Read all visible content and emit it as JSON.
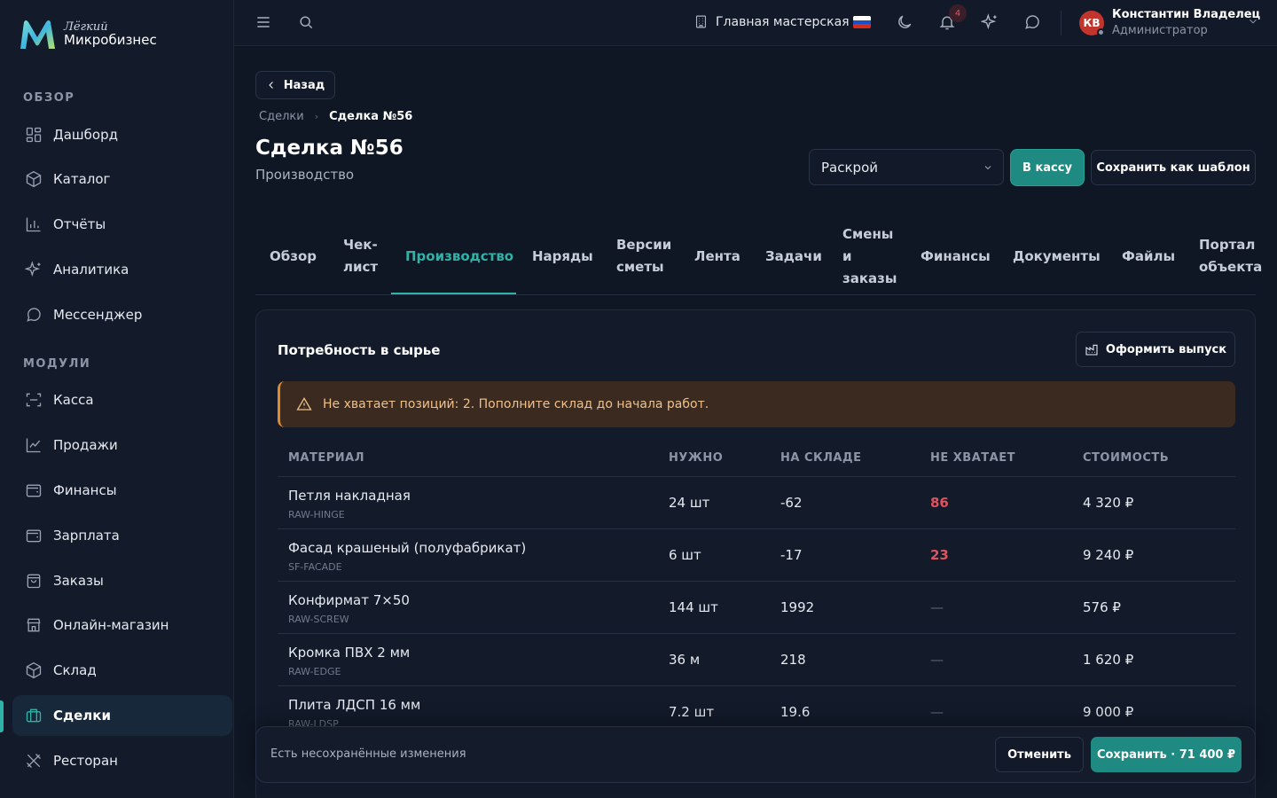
{
  "app": {
    "logo_top": "Лёгкий",
    "logo_bottom": "Микробизнес"
  },
  "sidebar": {
    "section_overview": "ОБЗОР",
    "section_modules": "МОДУЛИ",
    "items": [
      {
        "label": "Дашборд",
        "icon": "dashboard-icon"
      },
      {
        "label": "Каталог",
        "icon": "catalog-icon"
      },
      {
        "label": "Отчёты",
        "icon": "reports-icon"
      },
      {
        "label": "Аналитика",
        "icon": "sparkles-icon"
      },
      {
        "label": "Мессенджер",
        "icon": "chat-icon"
      },
      {
        "label": "Касса",
        "icon": "scan-icon"
      },
      {
        "label": "Продажи",
        "icon": "chart-line-icon"
      },
      {
        "label": "Финансы",
        "icon": "wallet-icon"
      },
      {
        "label": "Зарплата",
        "icon": "wallet-icon"
      },
      {
        "label": "Заказы",
        "icon": "shopping-bag-icon"
      },
      {
        "label": "Онлайн-магазин",
        "icon": "store-icon"
      },
      {
        "label": "Склад",
        "icon": "box-icon"
      },
      {
        "label": "Сделки",
        "icon": "briefcase-icon",
        "active": true
      },
      {
        "label": "Ресторан",
        "icon": "utensils-icon"
      }
    ]
  },
  "topbar": {
    "workshop": "Главная мастерская",
    "notifications_count": "4",
    "user_initials": "КВ",
    "user_name": "Константин Владелец",
    "user_role": "Администратор"
  },
  "page": {
    "back": "Назад",
    "breadcrumb_parent": "Сделки",
    "breadcrumb_current": "Сделка №56",
    "title": "Сделка №56",
    "subtitle": "Производство",
    "stage_select": "Раскрой",
    "to_cashier": "В кассу",
    "save_template": "Сохранить как шаблон"
  },
  "tabs": [
    {
      "label": "Обзор"
    },
    {
      "label": "Чек-\nлист"
    },
    {
      "label": "Производство",
      "active": true
    },
    {
      "label": "Наряды"
    },
    {
      "label": "Версии\nсметы"
    },
    {
      "label": "Лента"
    },
    {
      "label": "Задачи"
    },
    {
      "label": "Смены\nи\nзаказы"
    },
    {
      "label": "Финансы"
    },
    {
      "label": "Документы"
    },
    {
      "label": "Файлы"
    },
    {
      "label": "Портал\nобъекта"
    }
  ],
  "materials": {
    "title": "Потребность в сырье",
    "issue_button": "Оформить выпуск",
    "alert": "Не хватает позиций: 2. Пополните склад до начала работ.",
    "columns": [
      "МАТЕРИАЛ",
      "НУЖНО",
      "НА СКЛАДЕ",
      "НЕ ХВАТАЕТ",
      "СТОИМОСТЬ"
    ],
    "rows": [
      {
        "name": "Петля накладная",
        "sku": "RAW-HINGE",
        "need": "24 шт",
        "stock": "-62",
        "short": "86",
        "cost": "4 320 ₽"
      },
      {
        "name": "Фасад крашеный (полуфабрикат)",
        "sku": "SF-FACADE",
        "need": "6 шт",
        "stock": "-17",
        "short": "23",
        "cost": "9 240 ₽"
      },
      {
        "name": "Конфирмат 7×50",
        "sku": "RAW-SCREW",
        "need": "144 шт",
        "stock": "1992",
        "short": "—",
        "cost": "576 ₽"
      },
      {
        "name": "Кромка ПВХ 2 мм",
        "sku": "RAW-EDGE",
        "need": "36 м",
        "stock": "218",
        "short": "—",
        "cost": "1 620 ₽"
      },
      {
        "name": "Плита ЛДСП 16 мм",
        "sku": "RAW-LDSP",
        "need": "7.2 шт",
        "stock": "19.6",
        "short": "—",
        "cost": "9 000 ₽"
      }
    ]
  },
  "bottom_bar": {
    "unsaved": "Есть несохранённые изменения",
    "cancel": "Отменить",
    "save": "Сохранить · 71 400 ₽"
  },
  "colors": {
    "accent": "#2fb3a8",
    "danger": "#e0525d",
    "warning": "#e08a2c"
  }
}
